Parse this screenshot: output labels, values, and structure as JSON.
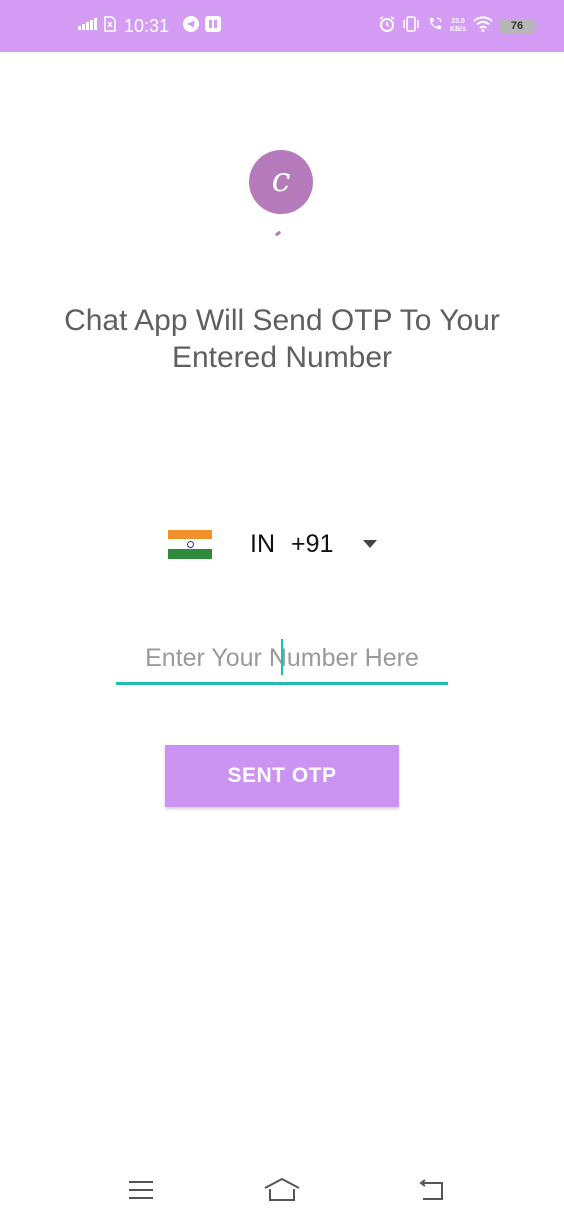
{
  "status_bar": {
    "time": "10:31",
    "net_speed_value": "33.0",
    "net_speed_unit": "KB/s",
    "battery_level": "76",
    "left_icons": [
      "signal-icon",
      "sim-icon",
      "telegram-icon",
      "app-icon"
    ],
    "right_icons": [
      "alarm-icon",
      "vibrate-icon",
      "wifi-call-icon",
      "wifi-icon",
      "battery-icon"
    ]
  },
  "logo": {
    "letter": "c"
  },
  "heading": {
    "line1": "Chat App Will Send OTP To Your",
    "line2": "Entered Number"
  },
  "country_picker": {
    "flag_icon": "india-flag-icon",
    "country_code": "IN",
    "dial_code": "+91"
  },
  "phone_input": {
    "placeholder": "Enter Your Number Here",
    "value": ""
  },
  "otp_button": {
    "label": "SENT OTP"
  },
  "nav_bar": {
    "icons": [
      "menu-icon",
      "home-icon",
      "back-icon"
    ]
  },
  "colors": {
    "status_bar": "#d49cf5",
    "logo_bg": "#b57ab9",
    "button": "#cb93f2",
    "input_underline": "#1ebfae",
    "heading_text": "#5f5f5f"
  }
}
